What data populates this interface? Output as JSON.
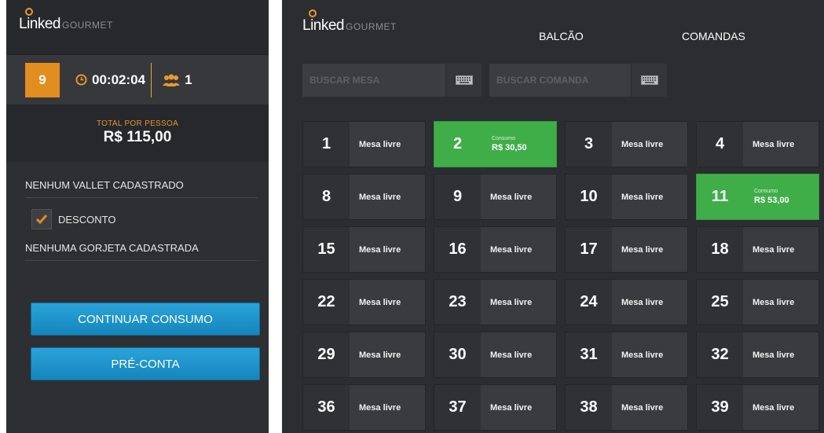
{
  "left_panel": {
    "logo": {
      "linked": "Linked",
      "gourmet": "GOURMET"
    },
    "table_number": "9",
    "timer": "00:02:04",
    "people_count": "1",
    "total_label": "TOTAL POR PESSOA",
    "total_value": "R$ 115,00",
    "vallet_text": "NENHUM VALLET CADASTRADO",
    "discount_label": "DESCONTO",
    "discount_checked": true,
    "gorjeta_text": "NENHUMA GORJETA CADASTRADA",
    "continue_button": "CONTINUAR CONSUMO",
    "precheck_button": "PRÉ-CONTA"
  },
  "right_panel": {
    "logo": {
      "linked": "Linked",
      "gourmet": "GOURMET"
    },
    "nav": {
      "balcao": "BALCÃO",
      "comandas": "COMANDAS"
    },
    "search_mesa_placeholder": "BUSCAR MESA",
    "search_comanda_placeholder": "BUSCAR COMANDA",
    "tables": [
      {
        "number": "1",
        "status": "Mesa livre"
      },
      {
        "number": "2",
        "status": "Consumo",
        "amount": "R$ 30,50"
      },
      {
        "number": "3",
        "status": "Mesa livre"
      },
      {
        "number": "4",
        "status": "Mesa livre"
      },
      {
        "number": "8",
        "status": "Mesa livre"
      },
      {
        "number": "9",
        "status": "Mesa livre"
      },
      {
        "number": "10",
        "status": "Mesa livre"
      },
      {
        "number": "11",
        "status": "Consumo",
        "amount": "R$ 53,00"
      },
      {
        "number": "15",
        "status": "Mesa livre"
      },
      {
        "number": "16",
        "status": "Mesa livre"
      },
      {
        "number": "17",
        "status": "Mesa livre"
      },
      {
        "number": "18",
        "status": "Mesa livre"
      },
      {
        "number": "22",
        "status": "Mesa livre"
      },
      {
        "number": "23",
        "status": "Mesa livre"
      },
      {
        "number": "24",
        "status": "Mesa livre"
      },
      {
        "number": "25",
        "status": "Mesa livre"
      },
      {
        "number": "29",
        "status": "Mesa livre"
      },
      {
        "number": "30",
        "status": "Mesa livre"
      },
      {
        "number": "31",
        "status": "Mesa livre"
      },
      {
        "number": "32",
        "status": "Mesa livre"
      },
      {
        "number": "36",
        "status": "Mesa livre"
      },
      {
        "number": "37",
        "status": "Mesa livre"
      },
      {
        "number": "38",
        "status": "Mesa livre"
      },
      {
        "number": "39",
        "status": "Mesa livre"
      }
    ]
  },
  "colors": {
    "accent_orange": "#e28d1f",
    "button_blue": "#1f95cc",
    "occupied_green": "#3fae49",
    "panel_dark": "#2e2f32"
  }
}
